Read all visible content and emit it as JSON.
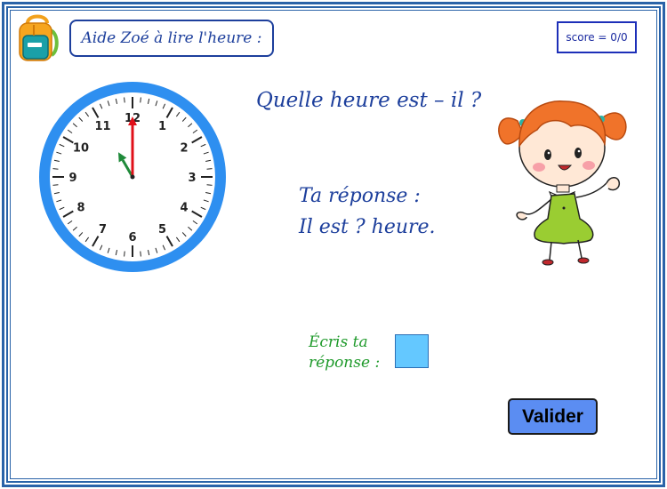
{
  "header": {
    "title": "Aide Zoé à lire l'heure :",
    "score": "score = 0/0"
  },
  "icons": {
    "backpack": "backpack-icon",
    "girl": "girl-illustration"
  },
  "clock": {
    "numbers": [
      "12",
      "1",
      "2",
      "3",
      "4",
      "5",
      "6",
      "7",
      "8",
      "9",
      "10",
      "11"
    ],
    "hour": 11,
    "minute": 0,
    "colors": {
      "rim": "#2e8ff0",
      "minute_hand": "#e0101a",
      "hour_hand": "#1f8a3a"
    }
  },
  "question": "Quelle heure est – il ?",
  "answer": {
    "line1": "Ta réponse :",
    "line2": "Il est ? heure."
  },
  "input": {
    "label_line1": "Écris ta",
    "label_line2": "réponse :",
    "value": ""
  },
  "validate_label": "Valider",
  "colors": {
    "frame": "#2a63a8",
    "title_text": "#1d3f9c",
    "green_text": "#1f9a2b",
    "input_bg": "#64c8ff",
    "button_bg": "#5b8df2"
  }
}
